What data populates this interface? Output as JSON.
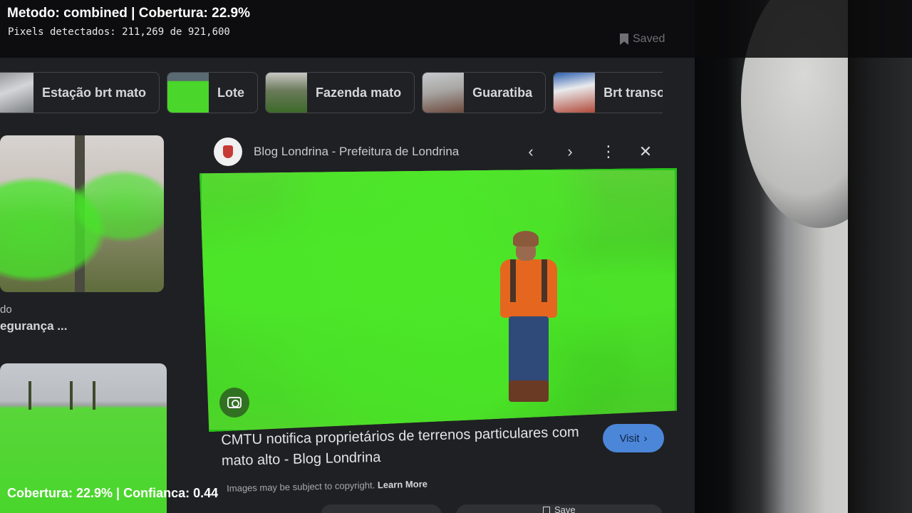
{
  "overlay": {
    "title": "Metodo: combined | Cobertura: 22.9%",
    "subtitle": "Pixels detectados: 211,269 de 921,600",
    "footer": "Cobertura: 22.9% | Confianca: 0.44"
  },
  "colors": {
    "vegetation_mask": "#4ce828",
    "mask_outline": "#27c41a",
    "visit_button": "#4c86d8"
  },
  "top_bar": {
    "saved_label": "Saved"
  },
  "chips": [
    {
      "label": "Estação brt mato"
    },
    {
      "label": "Lote"
    },
    {
      "label": "Fazenda mato"
    },
    {
      "label": "Guaratiba"
    },
    {
      "label": "Brt transoeste"
    }
  ],
  "left_results": {
    "item1_line1": "do",
    "item1_line2": "egurança ..."
  },
  "viewer": {
    "source_name": "Blog Londrina - Prefeitura de Londrina",
    "prev_icon": "chevron-left-icon",
    "next_icon": "chevron-right-icon",
    "more_icon": "more-vert-icon",
    "close_icon": "close-icon",
    "result_title": "CMTU notifica proprietários de terrenos particulares com mato alto - Blog Londrina",
    "visit_label": "Visit",
    "copyright_text": "Images may be subject to copyright.",
    "learn_more": "Learn More",
    "save_label": "Save"
  }
}
